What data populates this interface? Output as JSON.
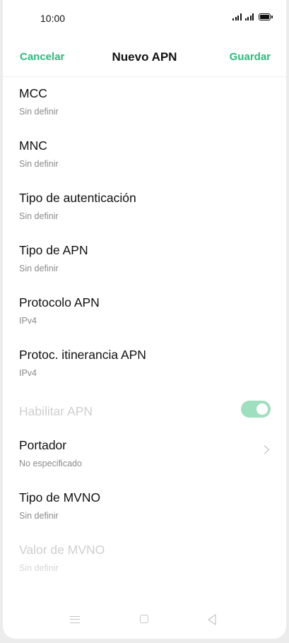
{
  "status_bar": {
    "time": "10:00",
    "icons": [
      "signal-icon",
      "signal-icon",
      "battery-icon"
    ]
  },
  "header": {
    "cancel_label": "Cancelar",
    "title": "Nuevo APN",
    "save_label": "Guardar",
    "accent_color": "#2dba7b"
  },
  "settings": [
    {
      "label": "MCC",
      "value": "Sin definir"
    },
    {
      "label": "MNC",
      "value": "Sin definir"
    },
    {
      "label": "Tipo de autenticación",
      "value": "Sin definir"
    },
    {
      "label": "Tipo de APN",
      "value": "Sin definir"
    },
    {
      "label": "Protocolo APN",
      "value": "IPv4"
    },
    {
      "label": "Protoc. itinerancia APN",
      "value": "IPv4"
    },
    {
      "label": "Habilitar APN",
      "toggle": true,
      "enabled": false
    },
    {
      "label": "Portador",
      "value": "No especificado",
      "icon": "chevron-right-icon"
    },
    {
      "label": "Tipo de MVNO",
      "value": "Sin definir"
    },
    {
      "label": "Valor de MVNO",
      "value": "Sin definir",
      "enabled": false
    }
  ],
  "nav_bar": {
    "icons": [
      "menu-icon",
      "home-icon",
      "back-icon"
    ]
  }
}
